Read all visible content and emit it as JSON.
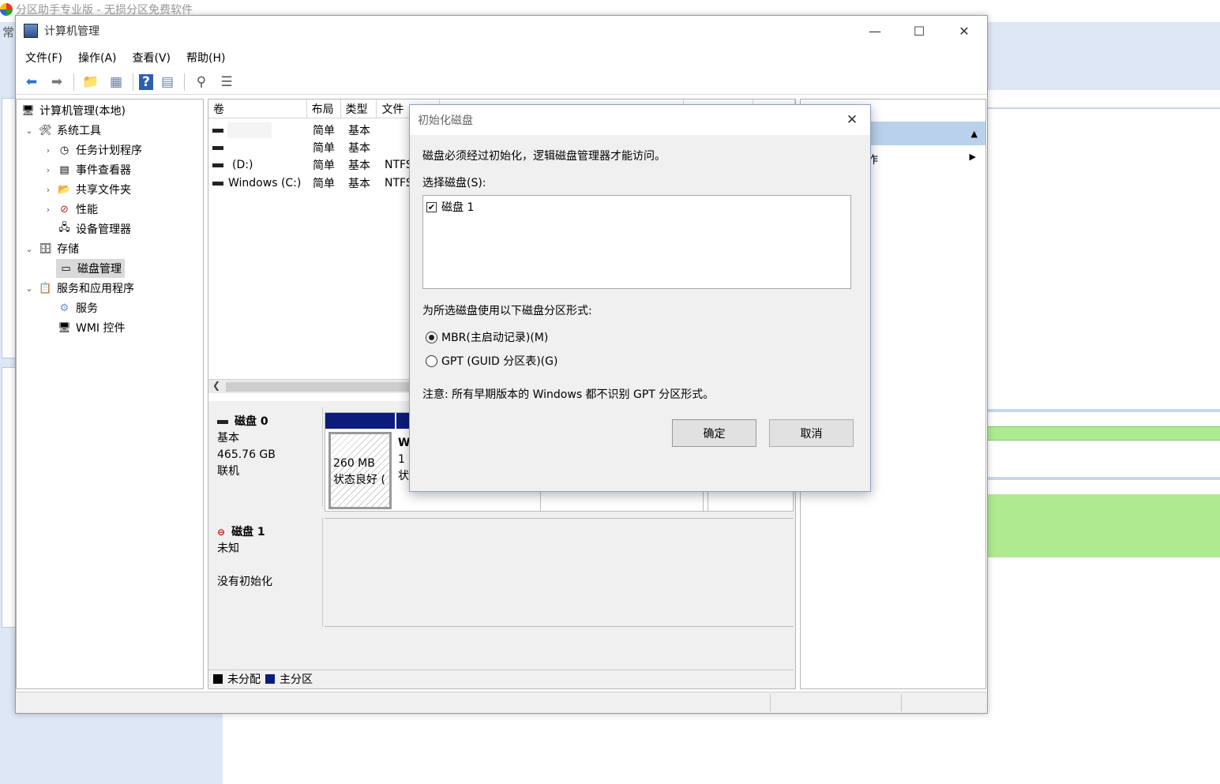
{
  "bg_app": {
    "title": "分区助手专业版 - 无损分区免费软件",
    "left_label": "常"
  },
  "window": {
    "title": "计算机管理",
    "controls": {
      "minimize": "—",
      "maximize": "☐",
      "close": "✕"
    }
  },
  "menu": [
    "文件(F)",
    "操作(A)",
    "查看(V)",
    "帮助(H)"
  ],
  "toolbar": {
    "icons": [
      "back-icon",
      "forward-icon",
      "up-folder-icon",
      "show-hide-tree-icon",
      "help-icon",
      "properties-icon",
      "connect-icon",
      "checklist-icon"
    ],
    "glyphs": [
      "⬅",
      "➡",
      "📁",
      "▦",
      "?",
      "▤",
      "⚲",
      "☰"
    ]
  },
  "tree": {
    "root": "计算机管理(本地)",
    "items": [
      {
        "label": "系统工具",
        "arrow": "⌄",
        "icon": "🛠"
      },
      {
        "label": "任务计划程序",
        "arrow": "›",
        "icon": "◷"
      },
      {
        "label": "事件查看器",
        "arrow": "›",
        "icon": "▤"
      },
      {
        "label": "共享文件夹",
        "arrow": "›",
        "icon": "📂"
      },
      {
        "label": "性能",
        "arrow": "›",
        "icon": "⊘"
      },
      {
        "label": "设备管理器",
        "arrow": "",
        "icon": "🖧"
      },
      {
        "label": "存储",
        "arrow": "⌄",
        "icon": "🗄"
      },
      {
        "label": "磁盘管理",
        "arrow": "",
        "icon": "▭"
      },
      {
        "label": "服务和应用程序",
        "arrow": "⌄",
        "icon": "📋"
      },
      {
        "label": "服务",
        "arrow": "",
        "icon": "⚙"
      },
      {
        "label": "WMI 控件",
        "arrow": "",
        "icon": "🖥"
      }
    ]
  },
  "volumes": {
    "headers": [
      "卷",
      "布局",
      "类型",
      "文件"
    ],
    "rows": [
      {
        "name": "",
        "layout": "简单",
        "type": "基本",
        "fs": ""
      },
      {
        "name": "",
        "layout": "简单",
        "type": "基本",
        "fs": ""
      },
      {
        "name": "(D:)",
        "layout": "简单",
        "type": "基本",
        "fs": "NTFS"
      },
      {
        "name": "Windows (C:)",
        "layout": "简单",
        "type": "基本",
        "fs": "NTFS"
      }
    ]
  },
  "disks": {
    "disk0": {
      "name": "磁盘 0",
      "type": "基本",
      "size": "465.76 GB",
      "status": "联机",
      "part1_size": "260 MB",
      "part1_status": "状态良好 (",
      "part2_label": "W",
      "part2_line2": "1",
      "part2_line3": "状"
    },
    "disk1": {
      "name": "磁盘 1",
      "type": "未知",
      "status": "没有初始化"
    }
  },
  "legend": [
    {
      "label": "未分配",
      "color": "#000000"
    },
    {
      "label": "主分区",
      "color": "#0c1c7a"
    }
  ],
  "action_pane": {
    "item": "作"
  },
  "dialog": {
    "title": "初始化磁盘",
    "intro": "磁盘必须经过初始化，逻辑磁盘管理器才能访问。",
    "select_label": "选择磁盘(S):",
    "disk_item": "磁盘 1",
    "disk_checked": true,
    "partition_style_label": "为所选磁盘使用以下磁盘分区形式:",
    "option_mbr": "MBR(主启动记录)(M)",
    "option_gpt": "GPT (GUID 分区表)(G)",
    "selected_option": "MBR",
    "note": "注意: 所有早期版本的 Windows 都不识别 GPT 分区形式。",
    "ok_label": "确定",
    "cancel_label": "取消"
  }
}
